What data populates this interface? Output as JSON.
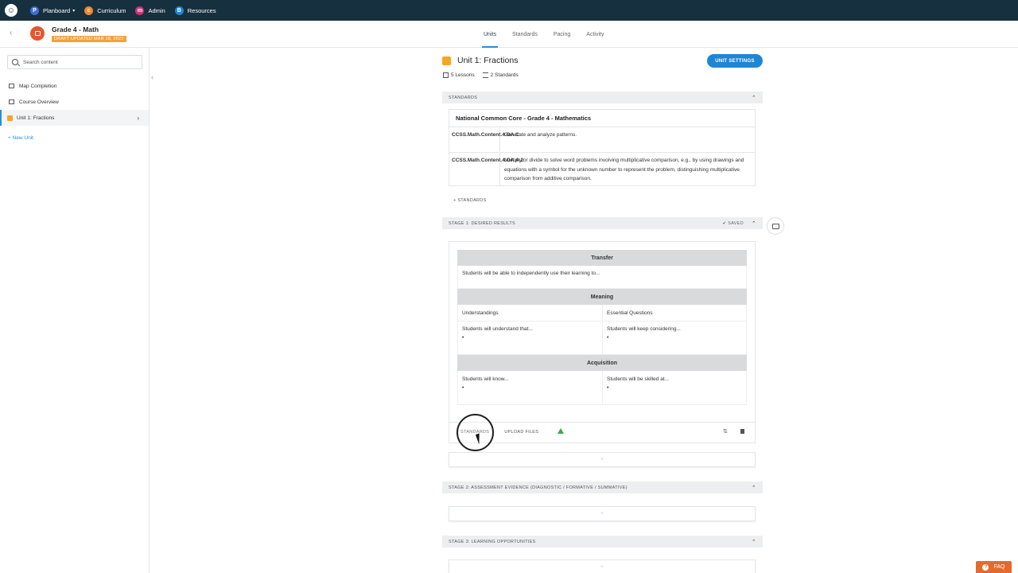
{
  "topnav": {
    "items": [
      {
        "label": "Planboard",
        "badge": "P",
        "color": "#3b6fd8"
      },
      {
        "label": "Curriculum",
        "badge": "c",
        "color": "#f0862e"
      },
      {
        "label": "Admin",
        "badge": "m",
        "color": "#d4317a"
      },
      {
        "label": "Resources",
        "badge": "B",
        "color": "#1d86d6"
      }
    ]
  },
  "header": {
    "course_title": "Grade 4 - Math",
    "draft_label": "DRAFT UPDATED MAR 18, 2022",
    "tabs": [
      {
        "label": "Units"
      },
      {
        "label": "Standards"
      },
      {
        "label": "Pacing"
      },
      {
        "label": "Activity"
      }
    ]
  },
  "sidebar": {
    "search_placeholder": "Search content",
    "items": [
      {
        "label": "Map Completion"
      },
      {
        "label": "Course Overview"
      },
      {
        "label": "Unit 1: Fractions"
      }
    ],
    "new_unit_label": "+ New Unit"
  },
  "unit": {
    "title": "Unit 1: Fractions",
    "lessons": "5 Lessons",
    "standards_count": "2 Standards",
    "settings_label": "UNIT SETTINGS"
  },
  "standards_section": {
    "bar_label": "STANDARDS",
    "framework_title": "National Common Core - Grade 4 - Mathematics",
    "rows": [
      {
        "code": "CCSS.Math.Content.4.OA.C",
        "description": "Generate and analyze patterns."
      },
      {
        "code": "CCSS.Math.Content.4.OA.A.2",
        "description": "Multiply or divide to solve word problems involving multiplicative comparison, e.g., by using drawings and equations with a symbol for the unknown number to represent the problem, distinguishing multiplicative comparison from additive comparison."
      }
    ],
    "add_label": "+ STANDARDS"
  },
  "stage1": {
    "bar_label": "STAGE 1: DESIRED RESULTS",
    "saved_label": "✔ SAVED",
    "transfer_header": "Transfer",
    "transfer_text": "Students will be able to independently use their learning to...",
    "meaning_header": "Meaning",
    "understandings_label": "Understandings",
    "essential_questions_label": "Essential Questions",
    "understand_text": "Students will understand that...",
    "considering_text": "Students will keep considering...",
    "acquisition_header": "Acquisition",
    "know_text": "Students will know...",
    "skilled_text": "Students will be skilled at...",
    "bullet": "•",
    "footer_standards": "STANDARDS",
    "footer_upload": "UPLOAD FILES"
  },
  "stage2": {
    "bar_label": "STAGE 2: ASSESSMENT EVIDENCE (DIAGNOSTIC / FORMATIVE / SUMMATIVE)"
  },
  "stage3": {
    "bar_label": "STAGE 3: LEARNING OPPORTUNITIES"
  },
  "plus": "+",
  "faq_label": "FAQ"
}
